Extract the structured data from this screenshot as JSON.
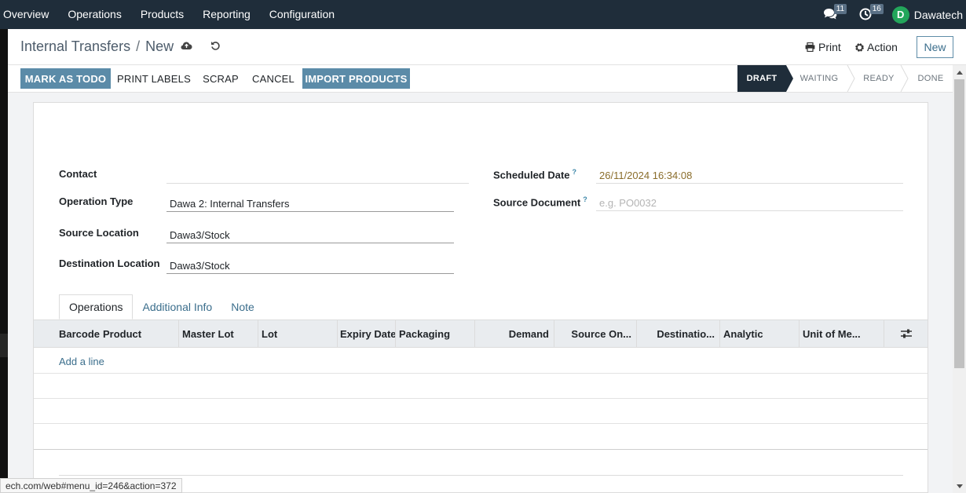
{
  "navbar": {
    "menu": [
      "Overview",
      "Operations",
      "Products",
      "Reporting",
      "Configuration"
    ],
    "messages_count": "11",
    "activities_count": "16",
    "user_initial": "D",
    "user_name": "Dawatech"
  },
  "control_panel": {
    "breadcrumb_parent": "Internal Transfers",
    "breadcrumb_separator": "/",
    "breadcrumb_current": "New",
    "print_label": "Print",
    "action_label": "Action",
    "new_label": "New"
  },
  "statusbar": {
    "buttons": [
      "MARK AS TODO",
      "PRINT LABELS",
      "SCRAP",
      "CANCEL",
      "IMPORT PRODUCTS"
    ],
    "stages": [
      "DRAFT",
      "WAITING",
      "READY",
      "DONE"
    ],
    "active_stage": "DRAFT"
  },
  "form": {
    "contact_label": "Contact",
    "contact_value": "",
    "operation_type_label": "Operation Type",
    "operation_type_value": "Dawa 2: Internal Transfers",
    "source_location_label": "Source Location",
    "source_location_value": "Dawa3/Stock",
    "destination_location_label": "Destination Location",
    "destination_location_value": "Dawa3/Stock",
    "scheduled_date_label": "Scheduled Date",
    "scheduled_date_value": "26/11/2024 16:34:08",
    "source_document_label": "Source Document",
    "source_document_placeholder": "e.g. PO0032",
    "help_mark": "?"
  },
  "tabs": [
    "Operations",
    "Additional Info",
    "Note"
  ],
  "table": {
    "columns": [
      "Barcode",
      "Product",
      "Master Lot",
      "Lot",
      "Expiry Date",
      "Packaging",
      "Demand",
      "Source On...",
      "Destinatio...",
      "Analytic",
      "Unit of Me..."
    ],
    "add_line": "Add a line"
  },
  "status_url": "ech.com/web#menu_id=246&action=372",
  "colors": {
    "navbar": "#1f2d3a",
    "primary_button": "#5b8ba8",
    "link": "#3b6e8c",
    "avatar": "#23a65b"
  }
}
